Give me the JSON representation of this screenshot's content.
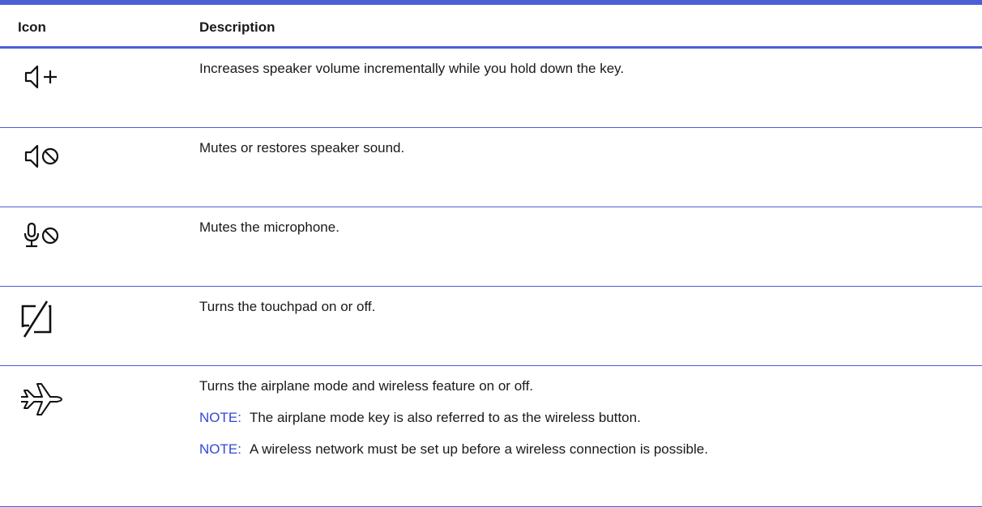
{
  "table": {
    "headers": {
      "icon": "Icon",
      "description": "Description"
    },
    "rows": [
      {
        "icon": "volume-up-icon",
        "description": "Increases speaker volume incrementally while you hold down the key.",
        "notes": []
      },
      {
        "icon": "speaker-mute-icon",
        "description": "Mutes or restores speaker sound.",
        "notes": []
      },
      {
        "icon": "microphone-mute-icon",
        "description": "Mutes the microphone.",
        "notes": []
      },
      {
        "icon": "touchpad-toggle-icon",
        "description": "Turns the touchpad on or off.",
        "notes": []
      },
      {
        "icon": "airplane-icon",
        "description": "Turns the airplane mode and wireless feature on or off.",
        "notes": [
          {
            "label": "NOTE:",
            "text": "The airplane mode key is also referred to as the wireless button."
          },
          {
            "label": "NOTE:",
            "text": "A wireless network must be set up before a wireless connection is possible."
          }
        ]
      }
    ]
  },
  "colors": {
    "accent": "#4a5fd6",
    "note": "#3346d8",
    "text": "#1a1a1a"
  }
}
